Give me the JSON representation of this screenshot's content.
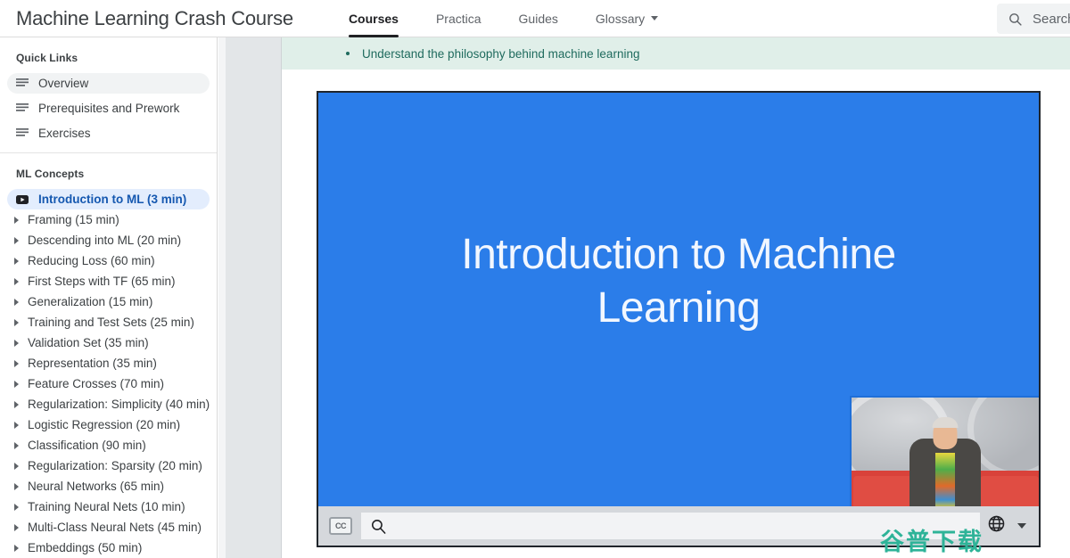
{
  "header": {
    "brand": "Machine Learning Crash Course",
    "nav": [
      {
        "label": "Courses",
        "active": true,
        "caret": false
      },
      {
        "label": "Practica",
        "active": false,
        "caret": false
      },
      {
        "label": "Guides",
        "active": false,
        "caret": false
      },
      {
        "label": "Glossary",
        "active": false,
        "caret": true
      }
    ],
    "search": {
      "icon": "search-icon",
      "placeholder": "Search"
    }
  },
  "sidebar": {
    "quick_links": {
      "title": "Quick Links",
      "items": [
        {
          "label": "Overview",
          "icon": "list-lines-icon",
          "state": "selected-gray"
        },
        {
          "label": "Prerequisites and Prework",
          "icon": "list-lines-icon",
          "state": "normal"
        },
        {
          "label": "Exercises",
          "icon": "list-lines-icon",
          "state": "normal"
        }
      ]
    },
    "ml_concepts": {
      "title": "ML Concepts",
      "items": [
        {
          "label": "Introduction to ML (3 min)",
          "icon": "video-icon",
          "state": "selected-blue"
        },
        {
          "label": "Framing (15 min)",
          "icon": "chevron-right-icon",
          "state": "collapsed"
        },
        {
          "label": "Descending into ML (20 min)",
          "icon": "chevron-right-icon",
          "state": "collapsed"
        },
        {
          "label": "Reducing Loss (60 min)",
          "icon": "chevron-right-icon",
          "state": "collapsed"
        },
        {
          "label": "First Steps with TF (65 min)",
          "icon": "chevron-right-icon",
          "state": "collapsed"
        },
        {
          "label": "Generalization (15 min)",
          "icon": "chevron-right-icon",
          "state": "collapsed"
        },
        {
          "label": "Training and Test Sets (25 min)",
          "icon": "chevron-right-icon",
          "state": "collapsed"
        },
        {
          "label": "Validation Set (35 min)",
          "icon": "chevron-right-icon",
          "state": "collapsed"
        },
        {
          "label": "Representation (35 min)",
          "icon": "chevron-right-icon",
          "state": "collapsed"
        },
        {
          "label": "Feature Crosses (70 min)",
          "icon": "chevron-right-icon",
          "state": "collapsed"
        },
        {
          "label": "Regularization: Simplicity (40 min)",
          "icon": "chevron-right-icon",
          "state": "collapsed"
        },
        {
          "label": "Logistic Regression (20 min)",
          "icon": "chevron-right-icon",
          "state": "collapsed"
        },
        {
          "label": "Classification (90 min)",
          "icon": "chevron-right-icon",
          "state": "collapsed"
        },
        {
          "label": "Regularization: Sparsity (20 min)",
          "icon": "chevron-right-icon",
          "state": "collapsed"
        },
        {
          "label": "Neural Networks (65 min)",
          "icon": "chevron-right-icon",
          "state": "collapsed"
        },
        {
          "label": "Training Neural Nets (10 min)",
          "icon": "chevron-right-icon",
          "state": "collapsed"
        },
        {
          "label": "Multi-Class Neural Nets (45 min)",
          "icon": "chevron-right-icon",
          "state": "collapsed"
        },
        {
          "label": "Embeddings (50 min)",
          "icon": "chevron-right-icon",
          "state": "collapsed"
        }
      ]
    }
  },
  "main": {
    "objective": "Understand the philosophy behind machine learning",
    "video": {
      "title": "Introduction to Machine Learning",
      "controls": {
        "cc_label": "CC",
        "cc_icon": "closed-caption-icon",
        "search_icon": "search-icon",
        "language_icon": "globe-icon",
        "language_caret_icon": "chevron-down-icon"
      }
    }
  },
  "watermark": "谷普下载",
  "colors": {
    "video_blue": "#2b7de9",
    "objective_bg": "#e0efe9",
    "objective_text": "#1f6b5e",
    "selected_blue_bg": "#e3edfd",
    "selected_blue_text": "#1558b0",
    "watermark": "#2eb398"
  }
}
